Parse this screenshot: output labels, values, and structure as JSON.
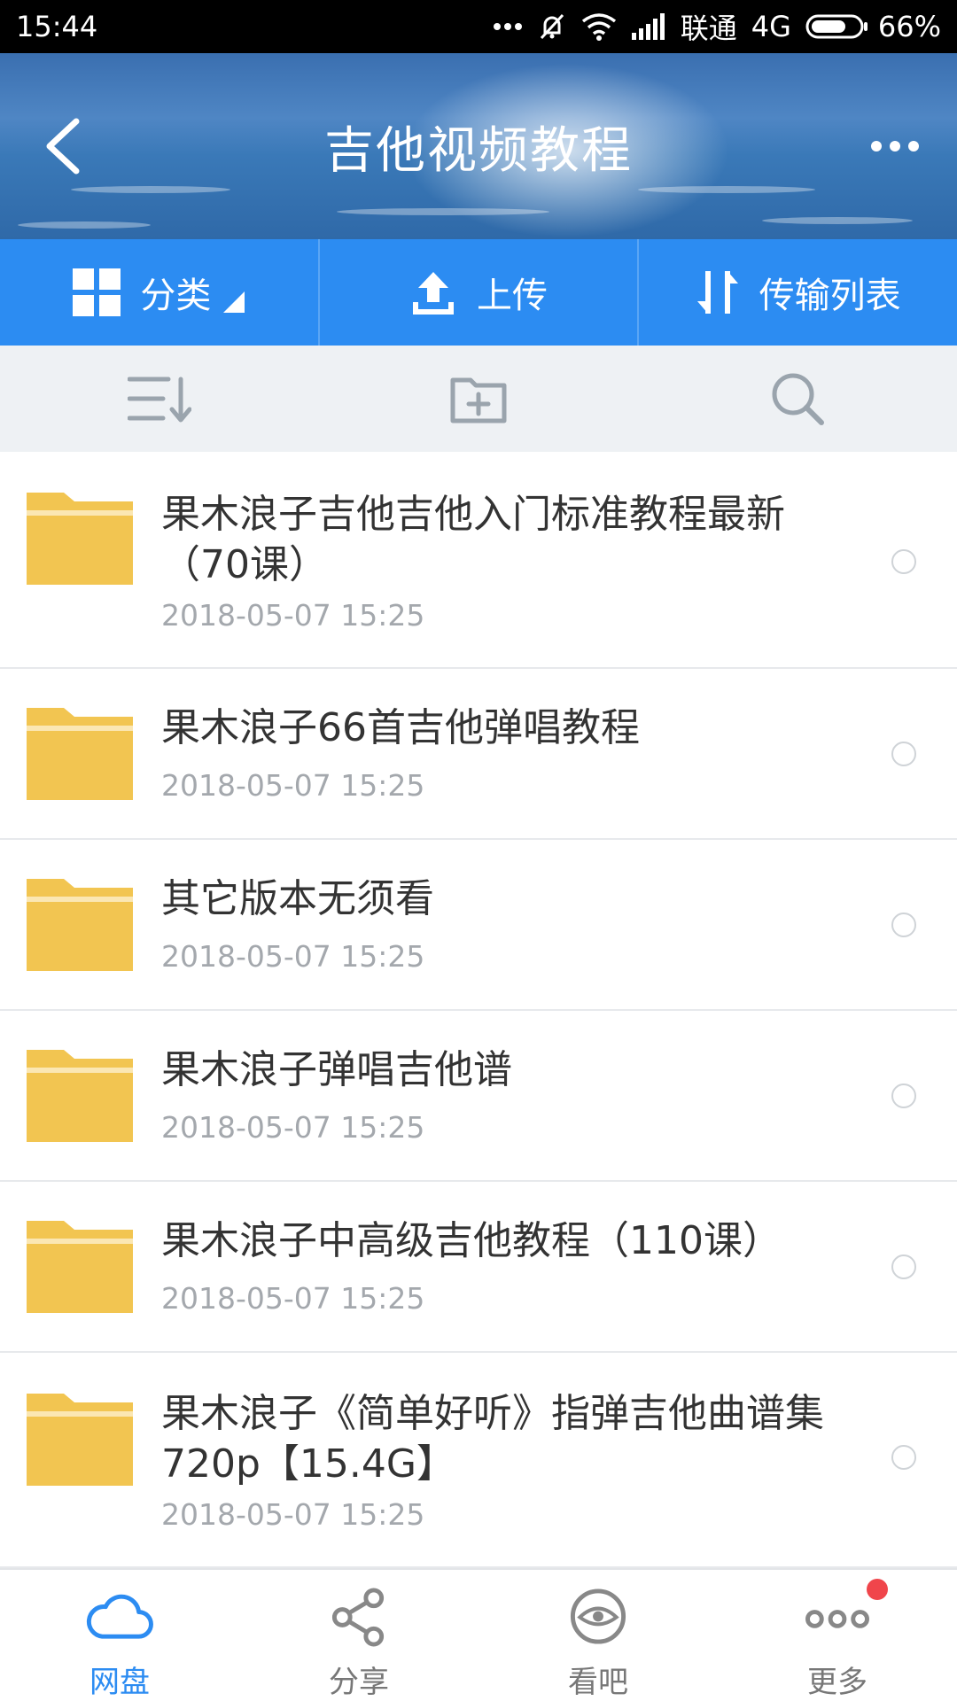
{
  "status_bar": {
    "time": "15:44",
    "carrier": "联通",
    "network": "4G",
    "battery": "66%"
  },
  "header": {
    "title": "吉他视频教程"
  },
  "action_bar": {
    "category_label": "分类",
    "upload_label": "上传",
    "transfer_label": "传输列表"
  },
  "files": [
    {
      "name": "果木浪子吉他吉他入门标准教程最新（70课）",
      "date": "2018-05-07  15:25",
      "icon": "folder-icon"
    },
    {
      "name": "果木浪子66首吉他弹唱教程",
      "date": "2018-05-07  15:25",
      "icon": "folder-icon"
    },
    {
      "name": "其它版本无须看",
      "date": "2018-05-07  15:25",
      "icon": "folder-icon"
    },
    {
      "name": "果木浪子弹唱吉他谱",
      "date": "2018-05-07  15:25",
      "icon": "folder-icon"
    },
    {
      "name": "果木浪子中高级吉他教程（110课）",
      "date": "2018-05-07  15:25",
      "icon": "folder-icon"
    },
    {
      "name": "果木浪子《简单好听》指弹吉他曲谱集720p【15.4G】",
      "date": "2018-05-07  15:25",
      "icon": "folder-icon"
    }
  ],
  "bottom_nav": {
    "items": [
      {
        "label": "网盘",
        "icon": "cloud-icon",
        "active": true
      },
      {
        "label": "分享",
        "icon": "share-icon",
        "active": false
      },
      {
        "label": "看吧",
        "icon": "eye-icon",
        "active": false
      },
      {
        "label": "更多",
        "icon": "more-icon",
        "active": false,
        "badge": true
      }
    ]
  },
  "colors": {
    "accent": "#2c8cf2",
    "folder": "#f2c551",
    "badge": "#f0454b"
  }
}
